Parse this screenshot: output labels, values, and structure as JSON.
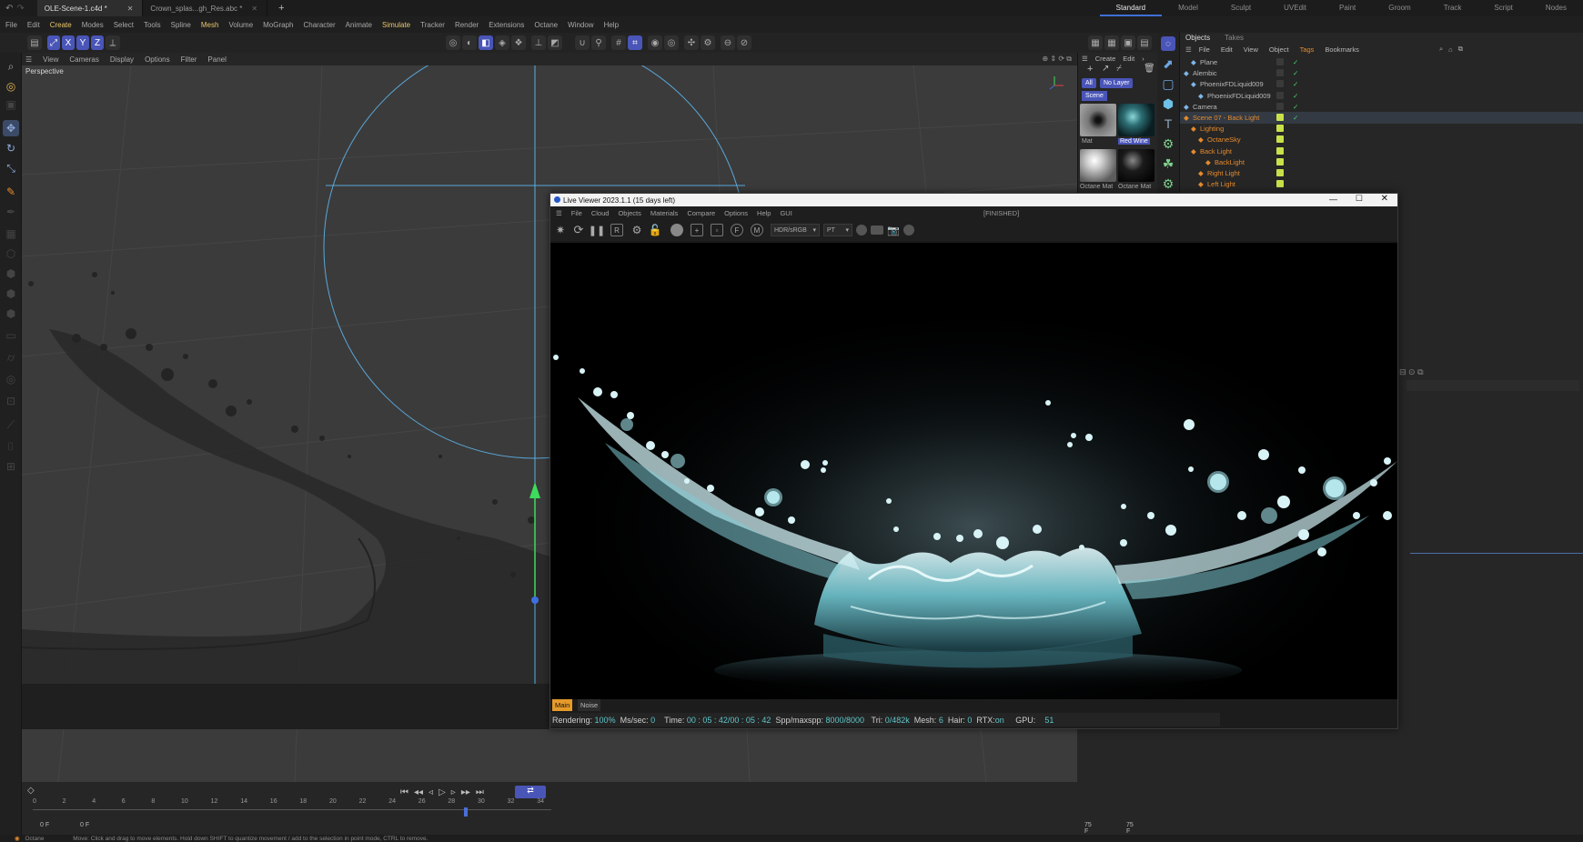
{
  "file_tabs": [
    {
      "label": "OLE-Scene-1.c4d *",
      "active": true
    },
    {
      "label": "Crown_splas...gh_Res.abc *",
      "active": false
    }
  ],
  "layouts": [
    "Standard",
    "Model",
    "Sculpt",
    "UVEdit",
    "Paint",
    "Groom",
    "Track",
    "Script",
    "Nodes"
  ],
  "current_layout": "Standard",
  "menu": [
    "File",
    "Edit",
    "Create",
    "Modes",
    "Select",
    "Tools",
    "Spline",
    "Mesh",
    "Volume",
    "MoGraph",
    "Character",
    "Animate",
    "Simulate",
    "Tracker",
    "Render",
    "Extensions",
    "Octane",
    "Window",
    "Help"
  ],
  "axis_labels": [
    "X",
    "Y",
    "Z"
  ],
  "viewport": {
    "menu": [
      "View",
      "Cameras",
      "Display",
      "Options",
      "Filter",
      "Panel"
    ],
    "label": "Perspective"
  },
  "materials": {
    "menu": [
      "Create",
      "Edit"
    ],
    "filters": [
      "All",
      "No Layer"
    ],
    "scene_tab": "Scene",
    "items": [
      "Mat",
      "Red Wine",
      "Octane Mat",
      "Octane Mat"
    ]
  },
  "objects": {
    "tabs": [
      "Objects",
      "Takes"
    ],
    "menu": [
      "File",
      "Edit",
      "View",
      "Object",
      "Tags",
      "Bookmarks"
    ],
    "rows": [
      {
        "name": "Plane",
        "indent": 1,
        "orange": false
      },
      {
        "name": "Alembic",
        "indent": 0,
        "orange": false
      },
      {
        "name": "PhoenixFDLiquid009",
        "indent": 1,
        "orange": false
      },
      {
        "name": "PhoenixFDLiquid009",
        "indent": 2,
        "orange": false
      },
      {
        "name": "Camera",
        "indent": 0,
        "orange": false
      },
      {
        "name": "Scene 07 - Back Light",
        "indent": 0,
        "orange": true
      },
      {
        "name": "Lighting",
        "indent": 1,
        "orange": true
      },
      {
        "name": "OctaneSky",
        "indent": 2,
        "orange": true
      },
      {
        "name": "Back Light",
        "indent": 1,
        "orange": true
      },
      {
        "name": "BackLight",
        "indent": 3,
        "orange": true
      },
      {
        "name": "Right Light",
        "indent": 2,
        "orange": true
      },
      {
        "name": "Left Light",
        "indent": 2,
        "orange": true
      }
    ]
  },
  "live_viewer": {
    "title": "Live Viewer 2023.1.1 (15 days left)",
    "menu": [
      "File",
      "Cloud",
      "Objects",
      "Materials",
      "Compare",
      "Options",
      "Help",
      "GUI"
    ],
    "state": "[FINISHED]",
    "color_space": "HDR/sRGB",
    "kernel": "PT",
    "tabs": [
      "Main",
      "Noise"
    ],
    "status": {
      "rendering_label": "Rendering:",
      "rendering": "100%",
      "ms_label": "Ms/sec:",
      "ms": "0",
      "time_label": "Time:",
      "time": "00 : 05 : 42/00 : 05 : 42",
      "spp_label": "Spp/maxspp:",
      "spp": "8000/8000",
      "tri_label": "Tri:",
      "tri": "0/482k",
      "mesh_label": "Mesh:",
      "mesh": "6",
      "hair_label": "Hair:",
      "hair": "0",
      "rtx_label": "RTX:",
      "rtx": "on",
      "gpu_label": "GPU:",
      "gpu": "51"
    }
  },
  "timeline": {
    "ticks": [
      "0",
      "2",
      "4",
      "6",
      "8",
      "10",
      "12",
      "14",
      "16",
      "18",
      "20",
      "22",
      "24",
      "26",
      "28",
      "30",
      "32",
      "34"
    ],
    "current_frame_marker": "29",
    "start": "0 F",
    "start2": "0 F",
    "end": "75 F",
    "end2": "75 F"
  },
  "status_bar": {
    "app": "Octane",
    "hint": "Move: Click and drag to move elements. Hold down SHIFT to quantize movement / add to the selection in point mode, CTRL to remove."
  }
}
